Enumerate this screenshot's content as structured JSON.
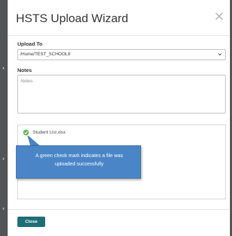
{
  "dialog": {
    "title": "HSTS Upload Wizard",
    "close_icon": "close-icon"
  },
  "upload_to": {
    "label": "Upload To",
    "value": "/Home/TEST_SCHOOL9"
  },
  "notes": {
    "label": "Notes",
    "placeholder": "Notes",
    "value": ""
  },
  "uploaded_files": [
    {
      "name": "Student List.xlsx",
      "status_icon": "green-check-icon"
    }
  ],
  "callout": {
    "line1": "A green check mark indicates a file was",
    "line2": "uploaded successfully"
  },
  "footer": {
    "close_label": "Close"
  },
  "colors": {
    "accent": "#1e6e76",
    "success": "#5cb85c",
    "callout": "#4a86c7"
  }
}
